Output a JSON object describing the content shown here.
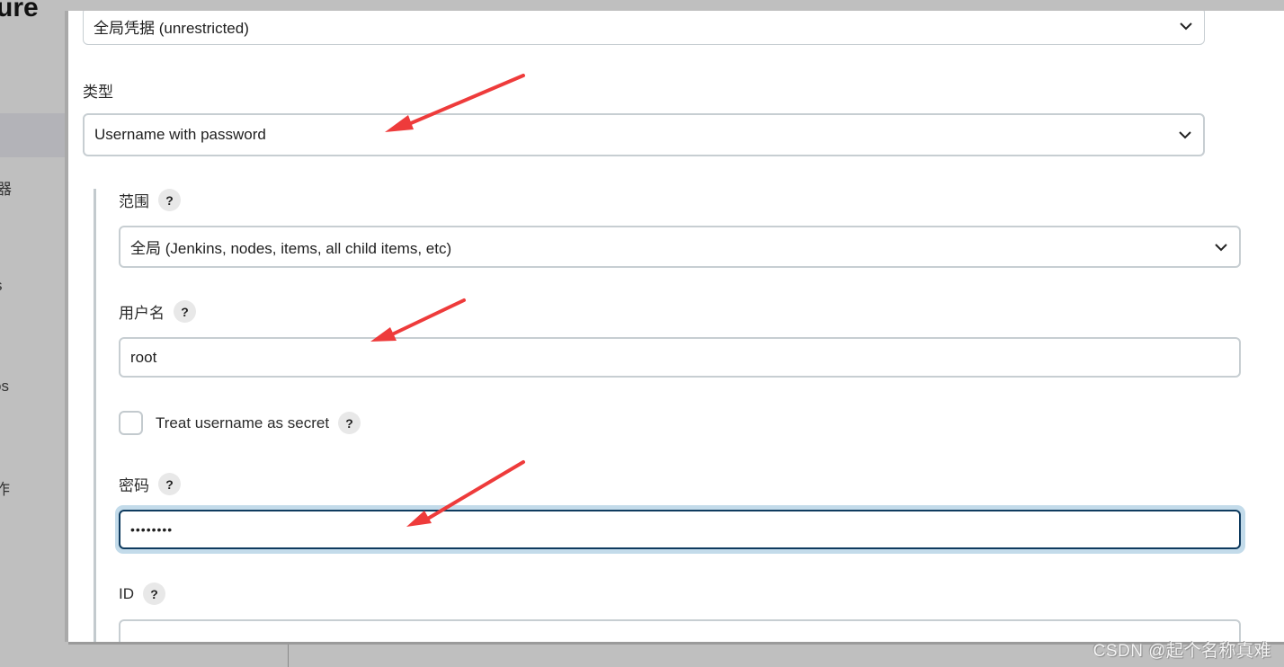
{
  "background_page": {
    "title_fragment": "ure",
    "sidebar_fragments": [
      "器",
      "s",
      "os",
      "作"
    ]
  },
  "form": {
    "domain_select": {
      "value": "全局凭据 (unrestricted)"
    },
    "kind": {
      "label": "类型",
      "value": "Username with password"
    },
    "scope": {
      "label": "范围",
      "value": "全局 (Jenkins, nodes, items, all child items, etc)"
    },
    "username": {
      "label": "用户名",
      "value": "root"
    },
    "username_secret": {
      "label": "Treat username as secret",
      "checked": false
    },
    "password": {
      "label": "密码",
      "value": "••••••••"
    },
    "id": {
      "label": "ID",
      "value": ""
    },
    "help_glyph": "?"
  },
  "annotations": {
    "arrow_color": "#ee3b3b"
  },
  "watermark": "CSDN @起个名称真难"
}
